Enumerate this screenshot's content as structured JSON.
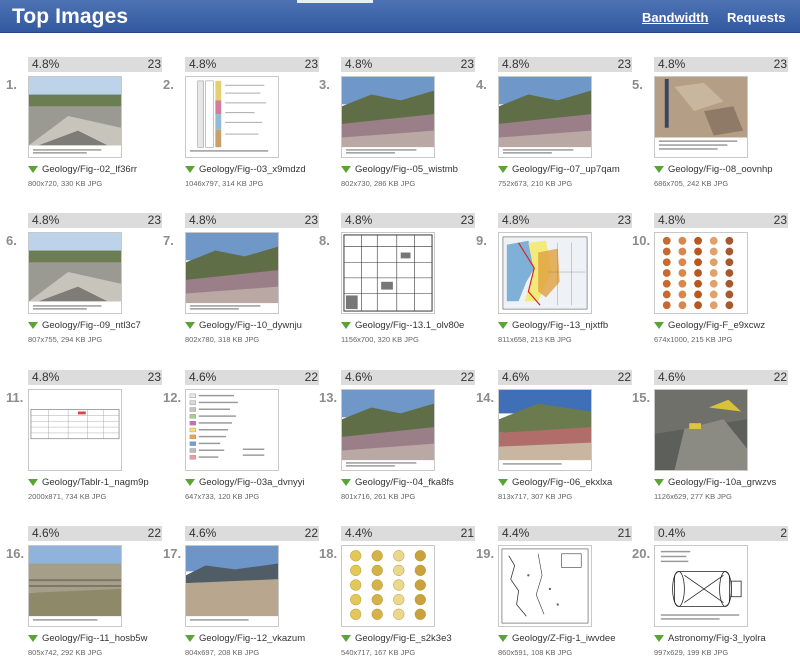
{
  "header": {
    "title": "Top Images",
    "tabs": [
      {
        "label": "Bandwidth",
        "active": true
      },
      {
        "label": "Requests",
        "active": false
      }
    ]
  },
  "colors": {
    "header_bg": "#3b64ad",
    "bar_bg": "#dcdcdc",
    "bar_fill": "#c9c9c9",
    "download_icon": "#5aa532"
  },
  "images": [
    {
      "rank": "1.",
      "pct": "4.8%",
      "pct_value": 4.8,
      "count": "23",
      "name": "Geology/Fig--02_lf36rr",
      "meta": "800x720, 330 KB JPG",
      "kind": "photo-quarry"
    },
    {
      "rank": "2.",
      "pct": "4.8%",
      "pct_value": 4.8,
      "count": "23",
      "name": "Geology/Fig--03_x9mdzd",
      "meta": "1046x797, 314 KB JPG",
      "kind": "diagram-column"
    },
    {
      "rank": "3.",
      "pct": "4.8%",
      "pct_value": 4.8,
      "count": "23",
      "name": "Geology/Fig--05_wistmb",
      "meta": "802x730, 286 KB JPG",
      "kind": "photo-hills"
    },
    {
      "rank": "4.",
      "pct": "4.8%",
      "pct_value": 4.8,
      "count": "23",
      "name": "Geology/Fig--07_up7qam",
      "meta": "752x673, 210 KB JPG",
      "kind": "photo-hills"
    },
    {
      "rank": "5.",
      "pct": "4.8%",
      "pct_value": 4.8,
      "count": "23",
      "name": "Geology/Fig--08_oovnhp",
      "meta": "686x705, 242 KB JPG",
      "kind": "photo-rock"
    },
    {
      "rank": "6.",
      "pct": "4.8%",
      "pct_value": 4.8,
      "count": "23",
      "name": "Geology/Fig--09_ntl3c7",
      "meta": "807x755, 294 KB JPG",
      "kind": "photo-quarry"
    },
    {
      "rank": "7.",
      "pct": "4.8%",
      "pct_value": 4.8,
      "count": "23",
      "name": "Geology/Fig--10_dywnju",
      "meta": "802x780, 318 KB JPG",
      "kind": "photo-hills"
    },
    {
      "rank": "8.",
      "pct": "4.8%",
      "pct_value": 4.8,
      "count": "23",
      "name": "Geology/Fig--13.1_olv80e",
      "meta": "1156x700, 320 KB JPG",
      "kind": "diagram-table"
    },
    {
      "rank": "9.",
      "pct": "4.8%",
      "pct_value": 4.8,
      "count": "23",
      "name": "Geology/Fig--13_njxtfb",
      "meta": "811x658, 213 KB JPG",
      "kind": "map"
    },
    {
      "rank": "10.",
      "pct": "4.8%",
      "pct_value": 4.8,
      "count": "23",
      "name": "Geology/Fig-F_e9xcwz",
      "meta": "674x1000, 215 KB JPG",
      "kind": "fossils-orange"
    },
    {
      "rank": "11.",
      "pct": "4.8%",
      "pct_value": 4.8,
      "count": "23",
      "name": "Geology/Tablr-1_nagm9p",
      "meta": "2000x871, 734 KB JPG",
      "kind": "diagram-table-wide"
    },
    {
      "rank": "12.",
      "pct": "4.6%",
      "pct_value": 4.6,
      "count": "22",
      "name": "Geology/Fig--03a_dvnyyi",
      "meta": "647x733, 120 KB JPG",
      "kind": "diagram-legend"
    },
    {
      "rank": "13.",
      "pct": "4.6%",
      "pct_value": 4.6,
      "count": "22",
      "name": "Geology/Fig--04_fka8fs",
      "meta": "801x716, 261 KB JPG",
      "kind": "photo-hills"
    },
    {
      "rank": "14.",
      "pct": "4.6%",
      "pct_value": 4.6,
      "count": "22",
      "name": "Geology/Fig--06_ekxlxa",
      "meta": "813x717, 307 KB JPG",
      "kind": "photo-red"
    },
    {
      "rank": "15.",
      "pct": "4.6%",
      "pct_value": 4.6,
      "count": "22",
      "name": "Geology/Fig--10a_grwzvs",
      "meta": "1126x629, 277 KB JPG",
      "kind": "photo-rock-dark"
    },
    {
      "rank": "16.",
      "pct": "4.6%",
      "pct_value": 4.6,
      "count": "22",
      "name": "Geology/Fig--11_hosb5w",
      "meta": "805x742, 292 KB JPG",
      "kind": "photo-cliff"
    },
    {
      "rank": "17.",
      "pct": "4.6%",
      "pct_value": 4.6,
      "count": "22",
      "name": "Geology/Fig--12_vkazum",
      "meta": "804x697, 208 KB JPG",
      "kind": "photo-plain"
    },
    {
      "rank": "18.",
      "pct": "4.4%",
      "pct_value": 4.4,
      "count": "21",
      "name": "Geology/Fig-E_s2k3e3",
      "meta": "540x717, 167 KB JPG",
      "kind": "fossils-yellow"
    },
    {
      "rank": "19.",
      "pct": "4.4%",
      "pct_value": 4.4,
      "count": "21",
      "name": "Geology/Z-Fig-1_iwvdee",
      "meta": "860x591, 108 KB JPG",
      "kind": "map-outline"
    },
    {
      "rank": "20.",
      "pct": "0.4%",
      "pct_value": 0.4,
      "count": "2",
      "name": "Astronomy/Fig-3_lyolra",
      "meta": "997x629, 199 KB JPG",
      "kind": "drawing"
    }
  ]
}
